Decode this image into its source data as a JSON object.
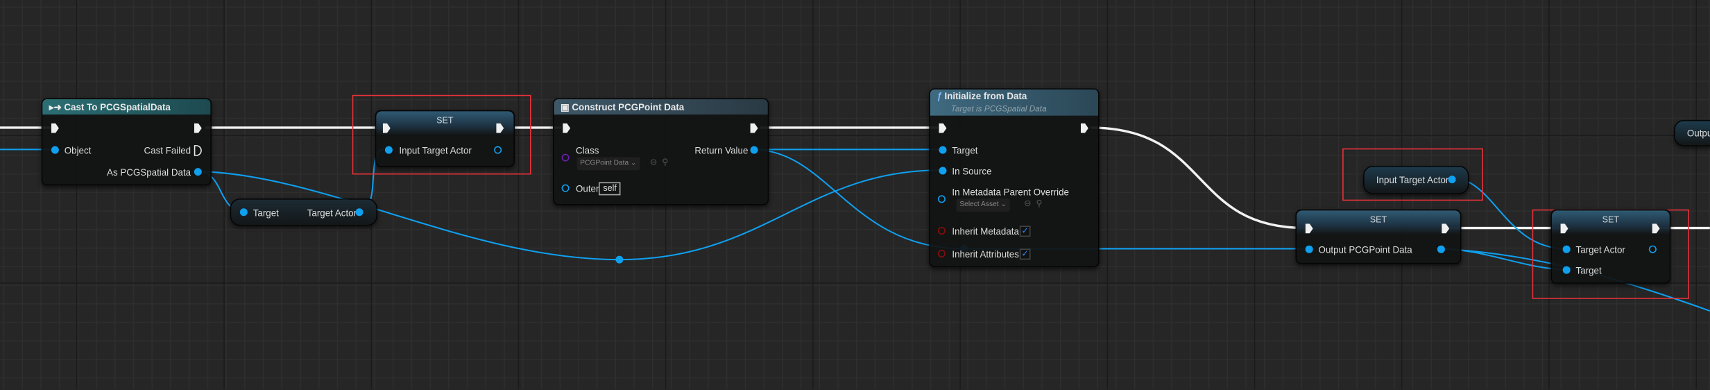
{
  "colors": {
    "background": "#262626",
    "exec_wire": "#ffffff",
    "object_wire": "#0fa0f0",
    "highlight_box": "#e8323a",
    "cast_header": "#1f6a6e",
    "function_header": "#3c6478"
  },
  "cast_node": {
    "title": "Cast To PCGSpatialData",
    "icon": "cast-icon",
    "object": "Object",
    "cast_failed": "Cast Failed",
    "as_output": "As PCGSpatial Data"
  },
  "get_target_actor": {
    "target": "Target",
    "output": "Target Actor"
  },
  "set_node_1": {
    "title": "SET",
    "input": "Input Target Actor"
  },
  "construct_node": {
    "title": "Construct PCGPoint Data",
    "icon": "class-icon",
    "class_label": "Class",
    "class_value": "PCGPoint Data",
    "outer_label": "Outer",
    "outer_value": "self",
    "return_value": "Return Value"
  },
  "initialize_node": {
    "title": "Initialize from Data",
    "subtitle": "Target is PCGSpatial Data",
    "icon": "function-icon",
    "target": "Target",
    "in_source": "In Source",
    "in_metadata": "In Metadata Parent Override",
    "select_asset": "Select Asset",
    "inherit_metadata": "Inherit Metadata",
    "inherit_metadata_checked": true,
    "inherit_attributes": "Inherit Attributes",
    "inherit_attributes_checked": true
  },
  "getter_node": {
    "label": "Input Target Actor"
  },
  "set_node_2": {
    "title": "SET",
    "input": "Output PCGPoint Data"
  },
  "set_node_3": {
    "title": "SET",
    "target_actor": "Target Actor",
    "target": "Target"
  },
  "output_node": {
    "label": "Outpu"
  }
}
